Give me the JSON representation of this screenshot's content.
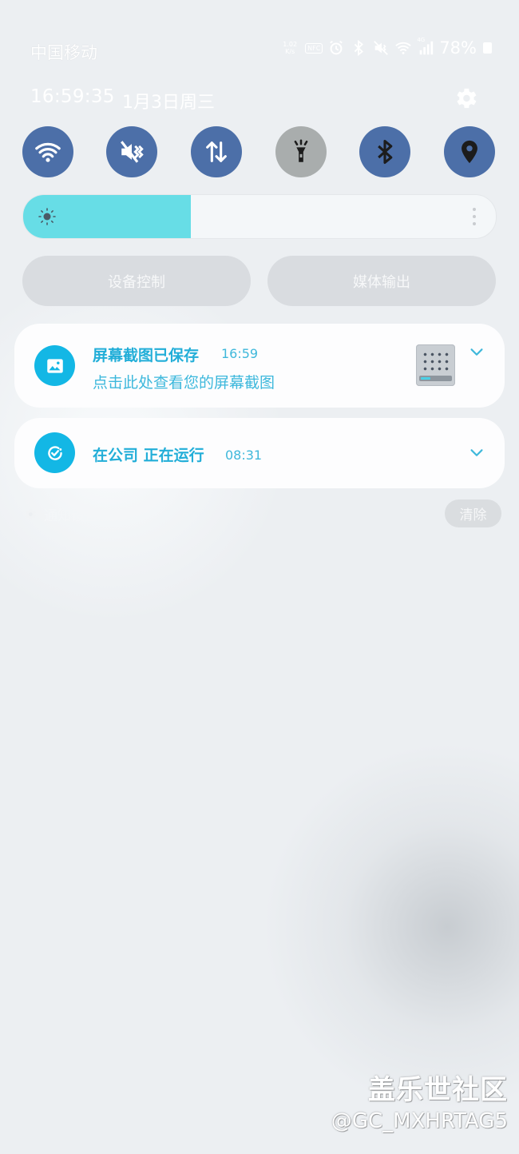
{
  "status_bar": {
    "carrier": "中国移动",
    "net_speed_value": "1.02",
    "net_speed_unit": "K/s",
    "nfc_label": "NFC",
    "signal_tag": "4G",
    "battery": "78%",
    "icons": [
      "net-speed",
      "nfc-icon",
      "alarm-icon",
      "bluetooth-icon",
      "mute-vibrate-icon",
      "wifi-icon",
      "signal-icon",
      "battery-icon"
    ]
  },
  "header": {
    "clock": "16:59:35",
    "date": "1月3日周三"
  },
  "quick_toggles": [
    {
      "name": "wifi",
      "active": true,
      "color": "#4c6fa8"
    },
    {
      "name": "sound-mute",
      "active": true,
      "color": "#4c6fa8"
    },
    {
      "name": "mobile-data",
      "active": true,
      "color": "#4c6fa8"
    },
    {
      "name": "flashlight",
      "active": false,
      "color": "#a9adad"
    },
    {
      "name": "bluetooth",
      "active": true,
      "color": "#4c6fa8"
    },
    {
      "name": "location",
      "active": true,
      "color": "#4c6fa8"
    }
  ],
  "brightness": {
    "level": 0.355,
    "fill_color": "#67dde6"
  },
  "controls": {
    "device_control": "设备控制",
    "media_output": "媒体输出"
  },
  "notifications": [
    {
      "title": "屏幕截图已保存",
      "time": "16:59",
      "body": "点击此处查看您的屏幕截图",
      "icon": "image-icon"
    },
    {
      "title": "在公司 正在运行",
      "time": "08:31",
      "icon": "routine-check-icon"
    }
  ],
  "footer": {
    "notification_settings": "通知设置",
    "clear": "清除"
  },
  "watermark": {
    "logo": "盖乐世社区",
    "user": "@GC_MXHRTAG5"
  },
  "colors": {
    "accent": "#13b7e5",
    "toggle_on": "#4c6fa8",
    "toggle_off": "#a9adad"
  }
}
